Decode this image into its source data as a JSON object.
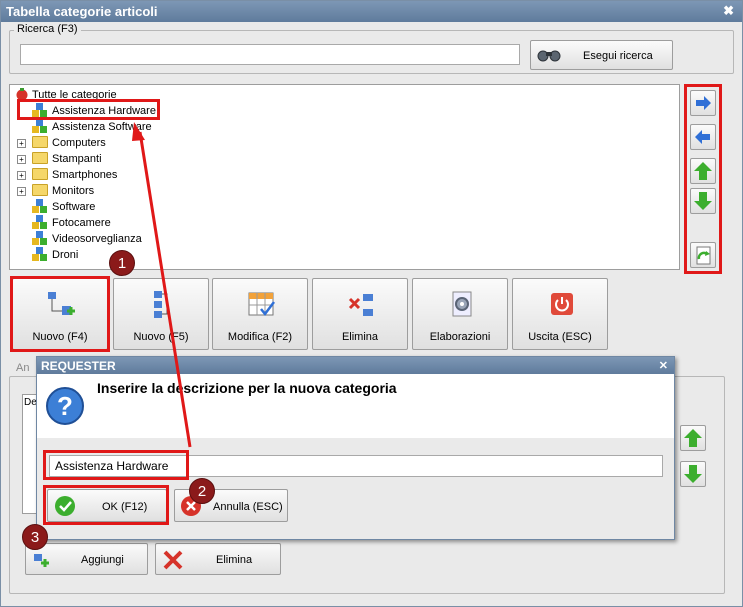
{
  "window": {
    "title": "Tabella categorie articoli",
    "close_glyph": "✖"
  },
  "search": {
    "group_label": "Ricerca (F3)",
    "value": "",
    "button_label": "Esegui ricerca"
  },
  "tree": {
    "root": "Tutte le categorie",
    "items": [
      {
        "label": "Assistenza Hardware",
        "kind": "cubes",
        "expandable": false
      },
      {
        "label": "Assistenza Software",
        "kind": "cubes",
        "expandable": false
      },
      {
        "label": "Computers",
        "kind": "folder",
        "expandable": true
      },
      {
        "label": "Stampanti",
        "kind": "folder",
        "expandable": true
      },
      {
        "label": "Smartphones",
        "kind": "folder",
        "expandable": true
      },
      {
        "label": "Monitors",
        "kind": "folder",
        "expandable": true
      },
      {
        "label": "Software",
        "kind": "cubes",
        "expandable": false
      },
      {
        "label": "Fotocamere",
        "kind": "cubes",
        "expandable": false
      },
      {
        "label": "Videosorveglianza",
        "kind": "cubes",
        "expandable": false
      },
      {
        "label": "Droni",
        "kind": "cubes",
        "expandable": false
      }
    ]
  },
  "toolbar": {
    "new_f4": "Nuovo (F4)",
    "new_f5": "Nuovo (F5)",
    "edit": "Modifica (F2)",
    "delete": "Elimina",
    "process": "Elaborazioni",
    "exit": "Uscita (ESC)"
  },
  "lower": {
    "tab_label": "An",
    "grid_header": "De",
    "add_label": "Aggiungi",
    "delete_label": "Elimina"
  },
  "dialog": {
    "title": "REQUESTER",
    "close_glyph": "✕",
    "message": "Inserire la descrizione per la nuova categoria",
    "input_value": "Assistenza Hardware",
    "ok_label": "OK (F12)",
    "cancel_label": "Annulla (ESC)"
  },
  "annotations": {
    "badge1": "1",
    "badge2": "2",
    "badge3": "3"
  },
  "colors": {
    "highlight": "#e01818",
    "badge": "#8b1a1a",
    "arrow_green": "#3cae2e",
    "arrow_blue": "#2f6fd6"
  }
}
